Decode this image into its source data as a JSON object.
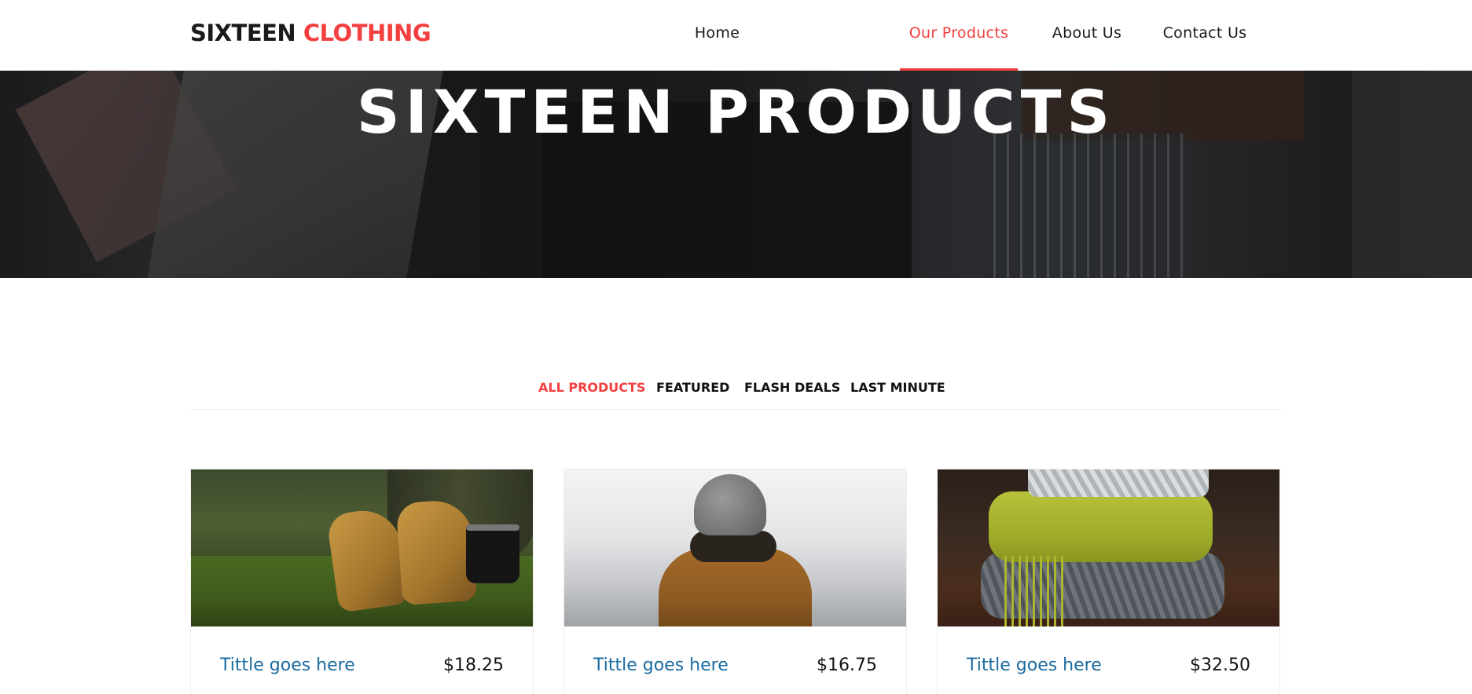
{
  "brand": {
    "part1": "SIXTEEN",
    "part2": "CLOTHING"
  },
  "nav": {
    "items": [
      {
        "label": "Home",
        "active": false
      },
      {
        "label": "Our Products",
        "active": true
      },
      {
        "label": "About Us",
        "active": false
      },
      {
        "label": "Contact Us",
        "active": false
      }
    ]
  },
  "hero": {
    "title": "SIXTEEN PRODUCTS"
  },
  "filters": {
    "items": [
      {
        "label": "ALL PRODUCTS",
        "active": true
      },
      {
        "label": "FEATURED",
        "active": false
      },
      {
        "label": "FLASH DEALS",
        "active": false
      },
      {
        "label": "LAST MINUTE",
        "active": false
      }
    ]
  },
  "products": [
    {
      "title": "Tittle goes here",
      "price": "$18.25",
      "image": "boots-on-moss"
    },
    {
      "title": "Tittle goes here",
      "price": "$16.75",
      "image": "person-in-beanie"
    },
    {
      "title": "Tittle goes here",
      "price": "$32.50",
      "image": "folded-scarves"
    }
  ],
  "colors": {
    "accent": "#f33f3f",
    "link": "#1a6ba0",
    "text": "#1a1a1a"
  }
}
